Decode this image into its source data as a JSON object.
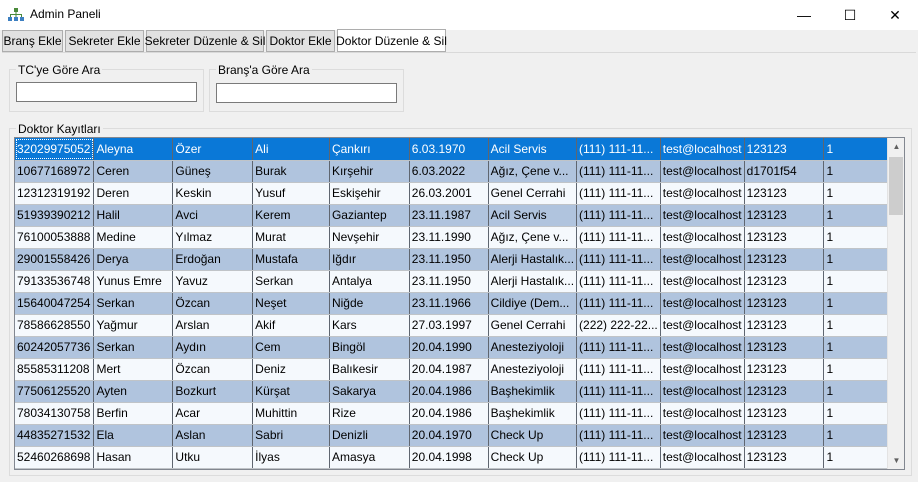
{
  "window": {
    "title": "Admin Paneli",
    "minimize_glyph": "—",
    "maximize_glyph": "☐",
    "close_glyph": "✕"
  },
  "tabs": [
    {
      "label": "Branş Ekle"
    },
    {
      "label": "Sekreter Ekle"
    },
    {
      "label": "Sekreter Düzenle & Sil"
    },
    {
      "label": "Doktor Ekle"
    },
    {
      "label": "Doktor Düzenle & Sil"
    }
  ],
  "filters": {
    "tc_label": "TC'ye Göre Ara",
    "tc_value": "",
    "brans_label": "Branş'a Göre Ara",
    "brans_value": ""
  },
  "records": {
    "label": "Doktor Kayıtları",
    "selected_row": 0,
    "rows": [
      [
        "32029975052",
        "Aleyna",
        "Özer",
        "Ali",
        "Çankırı",
        "6.03.1970",
        "Acil Servis",
        "(111) 111-11...",
        "test@localhost",
        "123123",
        "1"
      ],
      [
        "10677168972",
        "Ceren",
        "Güneş",
        "Burak",
        "Kırşehir",
        "6.03.2022",
        "Ağız, Çene v...",
        "(111) 111-11...",
        "test@localhost",
        "d1701f54",
        "1"
      ],
      [
        "12312319192",
        "Deren",
        "Keskin",
        "Yusuf",
        "Eskişehir",
        "26.03.2001",
        "Genel Cerrahi",
        "(111) 111-11...",
        "test@localhost",
        "123123",
        "1"
      ],
      [
        "51939390212",
        "Halil",
        "Avci",
        "Kerem",
        "Gaziantep",
        "23.11.1987",
        "Acil Servis",
        "(111) 111-11...",
        "test@localhost",
        "123123",
        "1"
      ],
      [
        "76100053888",
        "Medine",
        "Yılmaz",
        "Murat",
        "Nevşehir",
        "23.11.1990",
        "Ağız, Çene v...",
        "(111) 111-11...",
        "test@localhost",
        "123123",
        "1"
      ],
      [
        "29001558426",
        "Derya",
        "Erdoğan",
        "Mustafa",
        "Iğdır",
        "23.11.1950",
        "Alerji Hastalık...",
        "(111) 111-11...",
        "test@localhost",
        "123123",
        "1"
      ],
      [
        "79133536748",
        "Yunus Emre",
        "Yavuz",
        "Serkan",
        "Antalya",
        "23.11.1950",
        "Alerji Hastalık...",
        "(111) 111-11...",
        "test@localhost",
        "123123",
        "1"
      ],
      [
        "15640047254",
        "Serkan",
        "Özcan",
        "Neşet",
        "Niğde",
        "23.11.1966",
        "Cildiye (Dem...",
        "(111) 111-11...",
        "test@localhost",
        "123123",
        "1"
      ],
      [
        "78586628550",
        "Yağmur",
        "Arslan",
        "Akif",
        "Kars",
        "27.03.1997",
        "Genel Cerrahi",
        "(222) 222-22...",
        "test@localhost",
        "123123",
        "1"
      ],
      [
        "60242057736",
        "Serkan",
        "Aydın",
        "Cem",
        "Bingöl",
        "20.04.1990",
        "Anesteziyoloji",
        "(111) 111-11...",
        "test@localhost",
        "123123",
        "1"
      ],
      [
        "85585311208",
        "Mert",
        "Özcan",
        "Deniz",
        "Balıkesir",
        "20.04.1987",
        "Anesteziyoloji",
        "(111) 111-11...",
        "test@localhost",
        "123123",
        "1"
      ],
      [
        "77506125520",
        "Ayten",
        "Bozkurt",
        "Kürşat",
        "Sakarya",
        "20.04.1986",
        "Başhekimlik",
        "(111) 111-11...",
        "test@localhost",
        "123123",
        "1"
      ],
      [
        "78034130758",
        "Berfin",
        "Acar",
        "Muhittin",
        "Rize",
        "20.04.1986",
        "Başhekimlik",
        "(111) 111-11...",
        "test@localhost",
        "123123",
        "1"
      ],
      [
        "44835271532",
        "Ela",
        "Aslan",
        "Sabri",
        "Denizli",
        "20.04.1970",
        "Check Up",
        "(111) 111-11...",
        "test@localhost",
        "123123",
        "1"
      ],
      [
        "52460268698",
        "Hasan",
        "Utku",
        "İlyas",
        "Amasya",
        "20.04.1998",
        "Check Up",
        "(111) 111-11...",
        "test@localhost",
        "123123",
        "1"
      ]
    ]
  },
  "scrollbar": {
    "up_glyph": "▲",
    "down_glyph": "▼"
  },
  "colors": {
    "selection": "#0a78d7",
    "alt_row": "#b0c4de",
    "row": "#f5f9fd"
  },
  "icons": {
    "app": "org-chart-icon"
  }
}
